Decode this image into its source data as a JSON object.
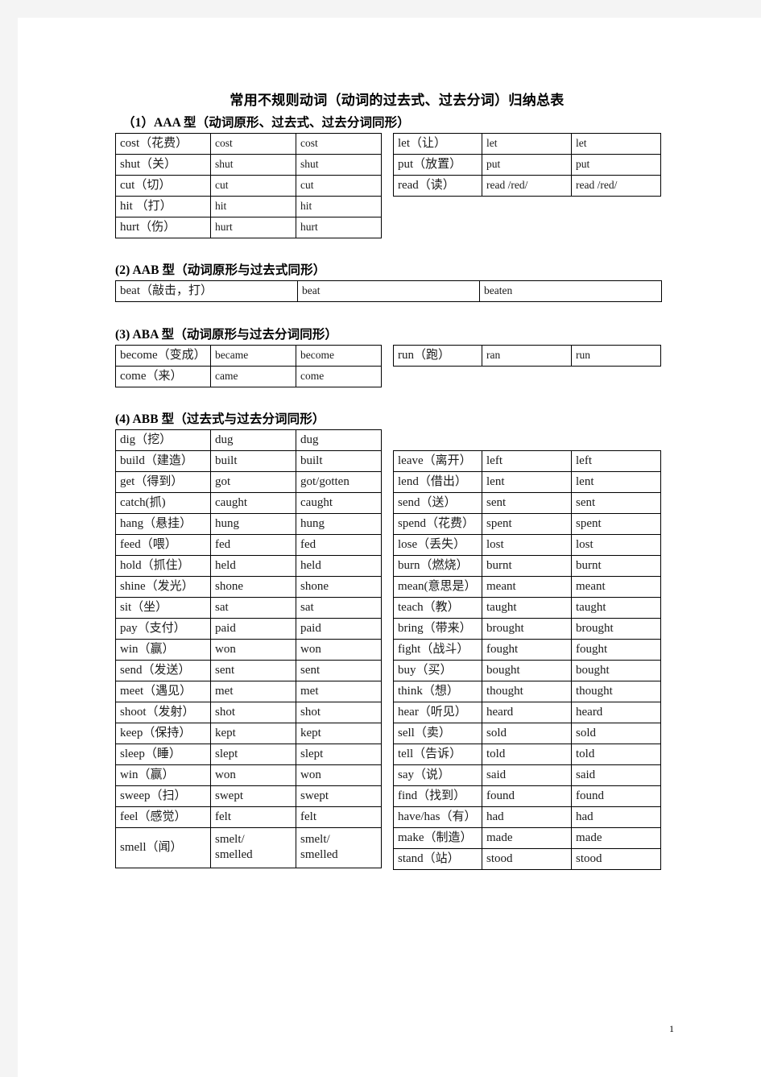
{
  "document": {
    "title": "常用不规则动词（动词的过去式、过去分词）归纳总表",
    "page_number": "1"
  },
  "sections": [
    {
      "heading": "（1）AAA 型（动词原形、过去式、过去分词同形）",
      "left_rows": [
        [
          "cost（花费）",
          "cost",
          "cost"
        ],
        [
          "shut（关）",
          "shut",
          "shut"
        ],
        [
          "cut（切）",
          "cut",
          "cut"
        ],
        [
          "hit （打）",
          "hit",
          "hit"
        ],
        [
          "hurt（伤）",
          "hurt",
          "hurt"
        ]
      ],
      "right_rows": [
        [
          "let（让）",
          "let",
          "let"
        ],
        [
          "put（放置）",
          "put",
          "put"
        ],
        [
          "read（读）",
          "read /red/",
          "read    /red/"
        ]
      ]
    },
    {
      "heading": "(2) AAB 型（动词原形与过去式同形）",
      "full_rows": [
        [
          "beat（敲击，打）",
          "beat",
          "beaten"
        ]
      ]
    },
    {
      "heading": "(3) ABA 型（动词原形与过去分词同形）",
      "left_rows": [
        [
          "become（变成）",
          "became",
          "become"
        ],
        [
          "come（来）",
          "came",
          "come"
        ]
      ],
      "right_rows": [
        [
          "run（跑）",
          "ran",
          "run"
        ]
      ]
    },
    {
      "heading": "(4) ABB 型（过去式与过去分词同形）",
      "left_rows": [
        [
          "dig（挖）",
          "dug",
          "dug"
        ],
        [
          "build（建造）",
          "built",
          "built"
        ],
        [
          "get（得到）",
          "got",
          "got/gotten"
        ],
        [
          "catch(抓)",
          "caught",
          "caught"
        ],
        [
          "hang（悬挂）",
          "hung",
          " hung"
        ],
        [
          "feed（喂）",
          "fed",
          "fed"
        ],
        [
          "hold（抓住）",
          "held",
          "held"
        ],
        [
          "shine（发光）",
          "shone",
          "shone"
        ],
        [
          "sit（坐）",
          "sat",
          "sat"
        ],
        [
          "pay（支付）",
          "paid",
          "paid"
        ],
        [
          "win（赢）",
          "won",
          " won"
        ],
        [
          "send（发送）",
          "sent",
          "sent"
        ],
        [
          "meet（遇见）",
          "met",
          "met"
        ],
        [
          "shoot（发射）",
          "shot",
          "shot"
        ],
        [
          "keep（保持）",
          "kept",
          "kept"
        ],
        [
          "sleep（睡）",
          "slept",
          "slept"
        ],
        [
          "win（赢）",
          "won",
          "won"
        ],
        [
          "sweep（扫）",
          "swept",
          "swept"
        ],
        [
          "feel（感觉）",
          "felt",
          "felt"
        ],
        [
          "smell（闻）",
          "smelt/\nsmelled",
          "smelt/\nsmelled"
        ]
      ],
      "right_rows": [
        [
          "leave（离开）",
          "left",
          "left"
        ],
        [
          "lend（借出）",
          "lent",
          "lent"
        ],
        [
          "send（送）",
          "sent",
          "sent"
        ],
        [
          "spend（花费）",
          "spent",
          "spent"
        ],
        [
          "lose（丢失）",
          "lost",
          "lost"
        ],
        [
          "burn（燃烧）",
          "burnt",
          "burnt"
        ],
        [
          "mean(意思是）",
          "meant",
          "meant"
        ],
        [
          "teach（教）",
          "taught",
          "taught"
        ],
        [
          "bring（带来）",
          "brought",
          "brought"
        ],
        [
          "fight（战斗）",
          "fought",
          "fought"
        ],
        [
          "buy（买）",
          "bought",
          "bought"
        ],
        [
          "think（想）",
          "thought",
          "thought"
        ],
        [
          "hear（听见）",
          "heard",
          "heard"
        ],
        [
          "sell（卖）",
          "sold",
          "sold"
        ],
        [
          "tell（告诉）",
          "told",
          "told"
        ],
        [
          "say（说）",
          "said",
          "said"
        ],
        [
          "find（找到）",
          "found",
          "found"
        ],
        [
          "have/has（有）",
          "had",
          "had"
        ],
        [
          "make（制造）",
          "made",
          "made"
        ],
        [
          "stand（站）",
          "stood",
          "stood"
        ]
      ]
    }
  ]
}
